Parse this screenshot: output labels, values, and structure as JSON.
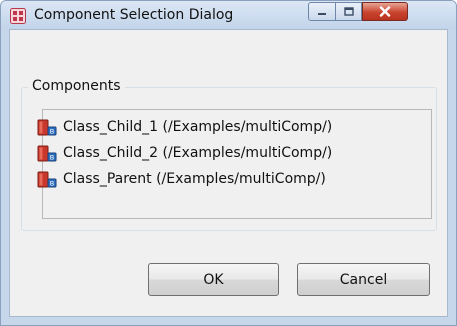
{
  "window": {
    "title": "Component Selection Dialog",
    "icon": "component-dialog-icon",
    "controls": {
      "minimize": "minimize-icon",
      "maximize": "maximize-icon",
      "close": "close-icon"
    }
  },
  "components_group": {
    "label": "Components",
    "items": [
      {
        "label": "Class_Child_1 (/Examples/multiComp/)",
        "icon": "class-component-icon"
      },
      {
        "label": "Class_Child_2 (/Examples/multiComp/)",
        "icon": "class-component-icon"
      },
      {
        "label": "Class_Parent (/Examples/multiComp/)",
        "icon": "class-component-icon"
      }
    ]
  },
  "buttons": {
    "ok": "OK",
    "cancel": "Cancel"
  },
  "colors": {
    "titlebar": "#c6d7ec",
    "close_button": "#c9442e",
    "dialog_background": "#f0f0f0"
  }
}
